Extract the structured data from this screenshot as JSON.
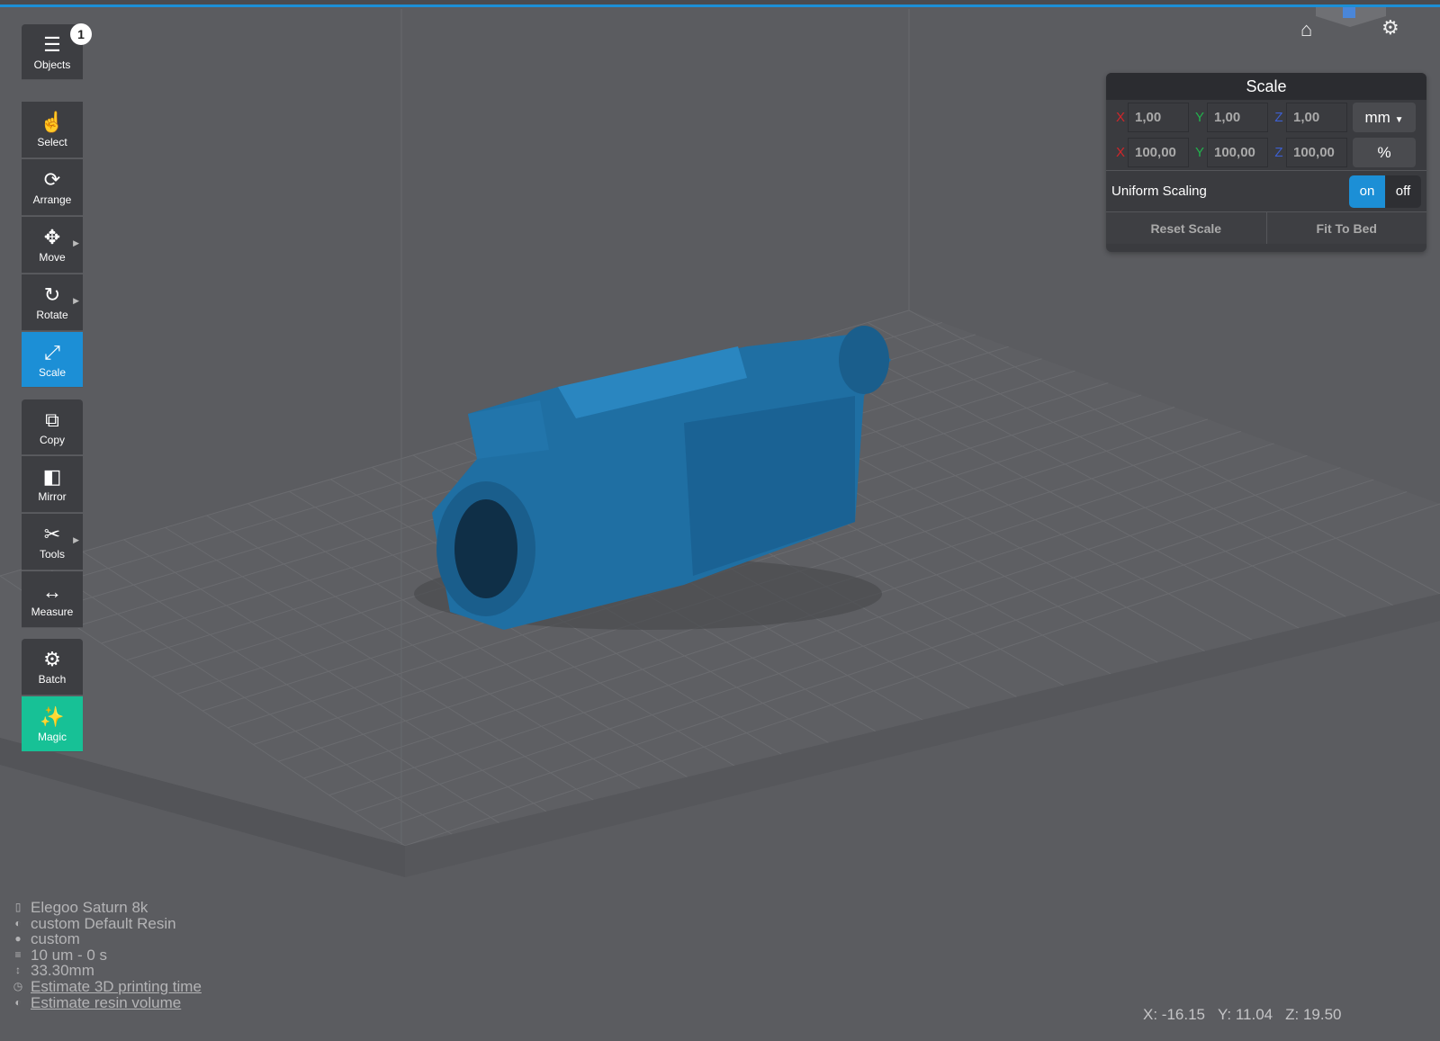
{
  "toolbar": {
    "objects_count": "1",
    "items": [
      {
        "label": "Objects",
        "icon": "list-icon"
      },
      {
        "label": "Select",
        "icon": "hand-pointer-icon"
      },
      {
        "label": "Arrange",
        "icon": "arrange-icon"
      },
      {
        "label": "Move",
        "icon": "move-icon"
      },
      {
        "label": "Rotate",
        "icon": "rotate-icon"
      },
      {
        "label": "Scale",
        "icon": "scale-icon"
      },
      {
        "label": "Copy",
        "icon": "copy-icon"
      },
      {
        "label": "Mirror",
        "icon": "mirror-icon"
      },
      {
        "label": "Tools",
        "icon": "scissors-icon"
      },
      {
        "label": "Measure",
        "icon": "measure-icon"
      },
      {
        "label": "Batch",
        "icon": "batch-icon"
      },
      {
        "label": "Magic",
        "icon": "magic-wand-icon"
      }
    ]
  },
  "scale_panel": {
    "title": "Scale",
    "axes": {
      "x": "X",
      "y": "Y",
      "z": "Z"
    },
    "mm": {
      "x": "1,00",
      "y": "1,00",
      "z": "1,00",
      "unit": "mm"
    },
    "percent": {
      "x": "100,00",
      "y": "100,00",
      "z": "100,00",
      "unit": "%"
    },
    "uniform_label": "Uniform Scaling",
    "on": "on",
    "off": "off",
    "reset": "Reset Scale",
    "fit": "Fit To Bed"
  },
  "info": {
    "printer": "Elegoo Saturn 8k",
    "resin": "custom Default Resin",
    "profile": "custom",
    "layer": "10 um - 0 s",
    "height": "33.30mm",
    "estimate_time": "Estimate 3D printing time",
    "estimate_volume": "Estimate resin volume"
  },
  "coords": {
    "x": "X: -16.15",
    "y": "Y: 11.04",
    "z": "Z: 19.50"
  },
  "colors": {
    "accent": "#1c8fd6",
    "magic": "#17c196",
    "model": "#1f6fa3"
  }
}
